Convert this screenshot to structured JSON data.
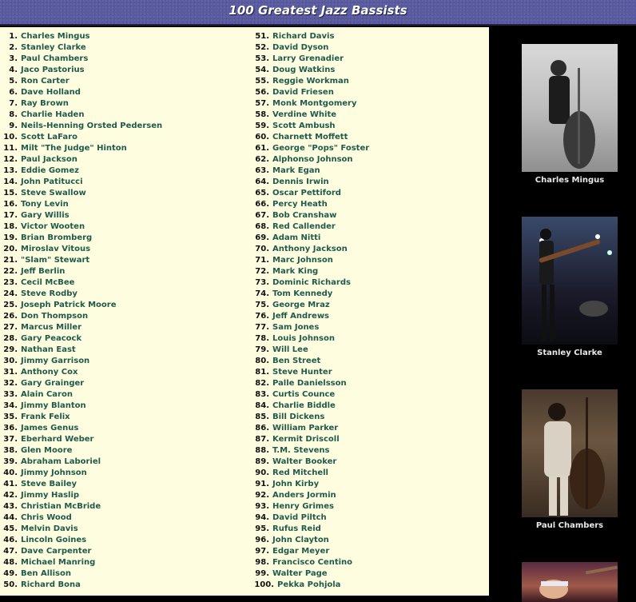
{
  "header": {
    "title": "100 Greatest Jazz Bassists"
  },
  "list_left": [
    {
      "n": "1.",
      "name": "Charles Mingus"
    },
    {
      "n": "2.",
      "name": "Stanley Clarke"
    },
    {
      "n": "3.",
      "name": "Paul Chambers"
    },
    {
      "n": "4.",
      "name": "Jaco Pastorius"
    },
    {
      "n": "5.",
      "name": "Ron Carter"
    },
    {
      "n": "6.",
      "name": "Dave Holland"
    },
    {
      "n": "7.",
      "name": "Ray Brown"
    },
    {
      "n": "8.",
      "name": "Charlie Haden"
    },
    {
      "n": "9.",
      "name": "Neils-Henning Orsted Pedersen"
    },
    {
      "n": "10.",
      "name": "Scott LaFaro"
    },
    {
      "n": "11.",
      "name": "Milt \"The Judge\" Hinton"
    },
    {
      "n": "12.",
      "name": "Paul Jackson"
    },
    {
      "n": "13.",
      "name": "Eddie Gomez"
    },
    {
      "n": "14.",
      "name": "John Patitucci"
    },
    {
      "n": "15.",
      "name": "Steve Swallow"
    },
    {
      "n": "16.",
      "name": "Tony Levin"
    },
    {
      "n": "17.",
      "name": "Gary Willis"
    },
    {
      "n": "18.",
      "name": "Victor Wooten"
    },
    {
      "n": "19.",
      "name": "Brian Bromberg"
    },
    {
      "n": "20.",
      "name": "Miroslav Vitous"
    },
    {
      "n": "21.",
      "name": "\"Slam\" Stewart"
    },
    {
      "n": "22.",
      "name": "Jeff Berlin"
    },
    {
      "n": "23.",
      "name": "Cecil McBee"
    },
    {
      "n": "24.",
      "name": "Steve Rodby"
    },
    {
      "n": "25.",
      "name": "Joseph Patrick Moore"
    },
    {
      "n": "26.",
      "name": "Don Thompson"
    },
    {
      "n": "27.",
      "name": "Marcus Miller"
    },
    {
      "n": "28.",
      "name": "Gary Peacock"
    },
    {
      "n": "29.",
      "name": "Nathan East"
    },
    {
      "n": "30.",
      "name": "Jimmy Garrison"
    },
    {
      "n": "31.",
      "name": "Anthony Cox"
    },
    {
      "n": "32.",
      "name": "Gary Grainger"
    },
    {
      "n": "33.",
      "name": "Alain Caron"
    },
    {
      "n": "34.",
      "name": "Jimmy Blanton"
    },
    {
      "n": "35.",
      "name": "Frank Felix"
    },
    {
      "n": "36.",
      "name": "James Genus"
    },
    {
      "n": "37.",
      "name": "Eberhard Weber"
    },
    {
      "n": "38.",
      "name": "Glen Moore"
    },
    {
      "n": "39.",
      "name": "Abraham Laboriel"
    },
    {
      "n": "40.",
      "name": "Jimmy Johnson"
    },
    {
      "n": "41.",
      "name": "Steve Bailey"
    },
    {
      "n": "42.",
      "name": "Jimmy Haslip"
    },
    {
      "n": "43.",
      "name": "Christian McBride"
    },
    {
      "n": "44.",
      "name": "Chris Wood"
    },
    {
      "n": "45.",
      "name": "Melvin Davis"
    },
    {
      "n": "46.",
      "name": "Lincoln Goines"
    },
    {
      "n": "47.",
      "name": "Dave Carpenter"
    },
    {
      "n": "48.",
      "name": "Michael Manring"
    },
    {
      "n": "49.",
      "name": "Ben Allison"
    },
    {
      "n": "50.",
      "name": "Richard Bona"
    }
  ],
  "list_right": [
    {
      "n": "51.",
      "name": "Richard Davis"
    },
    {
      "n": "52.",
      "name": "David Dyson"
    },
    {
      "n": "53.",
      "name": "Larry Grenadier"
    },
    {
      "n": "54.",
      "name": "Doug Watkins"
    },
    {
      "n": "55.",
      "name": "Reggie Workman"
    },
    {
      "n": "56.",
      "name": "David Friesen"
    },
    {
      "n": "57.",
      "name": "Monk Montgomery"
    },
    {
      "n": "58.",
      "name": "Verdine White"
    },
    {
      "n": "59.",
      "name": "Scott Ambush"
    },
    {
      "n": "60.",
      "name": "Charnett Moffett"
    },
    {
      "n": "61.",
      "name": "George \"Pops\" Foster"
    },
    {
      "n": "62.",
      "name": "Alphonso Johnson"
    },
    {
      "n": "63.",
      "name": "Mark Egan"
    },
    {
      "n": "64.",
      "name": "Dennis Irwin"
    },
    {
      "n": "65.",
      "name": "Oscar Pettiford"
    },
    {
      "n": "66.",
      "name": "Percy Heath"
    },
    {
      "n": "67.",
      "name": "Bob Cranshaw"
    },
    {
      "n": "68.",
      "name": "Red Callender"
    },
    {
      "n": "69.",
      "name": "Adam Nitti"
    },
    {
      "n": "70.",
      "name": "Anthony Jackson"
    },
    {
      "n": "71.",
      "name": "Marc Johnson"
    },
    {
      "n": "72.",
      "name": "Mark King"
    },
    {
      "n": "73.",
      "name": "Dominic Richards"
    },
    {
      "n": "74.",
      "name": "Tom Kennedy"
    },
    {
      "n": "75.",
      "name": "George Mraz"
    },
    {
      "n": "76.",
      "name": "Jeff Andrews"
    },
    {
      "n": "77.",
      "name": "Sam Jones"
    },
    {
      "n": "78.",
      "name": "Louis Johnson"
    },
    {
      "n": "79.",
      "name": "Will Lee"
    },
    {
      "n": "80.",
      "name": "Ben Street"
    },
    {
      "n": "81.",
      "name": "Steve Hunter"
    },
    {
      "n": "82.",
      "name": "Palle Danielsson"
    },
    {
      "n": "83.",
      "name": "Curtis Counce"
    },
    {
      "n": "84.",
      "name": "Charlie Biddle"
    },
    {
      "n": "85.",
      "name": "Bill Dickens"
    },
    {
      "n": "86.",
      "name": "William Parker"
    },
    {
      "n": "87.",
      "name": "Kermit Driscoll"
    },
    {
      "n": "88.",
      "name": "T.M. Stevens"
    },
    {
      "n": "89.",
      "name": "Walter Booker"
    },
    {
      "n": "90.",
      "name": "Red Mitchell"
    },
    {
      "n": "91.",
      "name": "John Kirby"
    },
    {
      "n": "92.",
      "name": "Anders Jormin"
    },
    {
      "n": "93.",
      "name": "Henry Grimes"
    },
    {
      "n": "94.",
      "name": "David Piltch"
    },
    {
      "n": "95.",
      "name": "Rufus Reid"
    },
    {
      "n": "96.",
      "name": "John Clayton"
    },
    {
      "n": "97.",
      "name": "Edgar Meyer"
    },
    {
      "n": "98.",
      "name": "Francisco Centino"
    },
    {
      "n": "99.",
      "name": "Walter Page"
    },
    {
      "n": "100.",
      "name": "Pekka Pohjola"
    }
  ],
  "photos": [
    {
      "caption": "Charles Mingus"
    },
    {
      "caption": "Stanley Clarke"
    },
    {
      "caption": "Paul Chambers"
    },
    {
      "caption": ""
    }
  ],
  "colors": {
    "header_bg": "#5a5aa0",
    "list_bg": "#fffde0",
    "name_text": "#1f5a4a",
    "number_text": "#111111",
    "photo_column_bg": "#000000"
  }
}
